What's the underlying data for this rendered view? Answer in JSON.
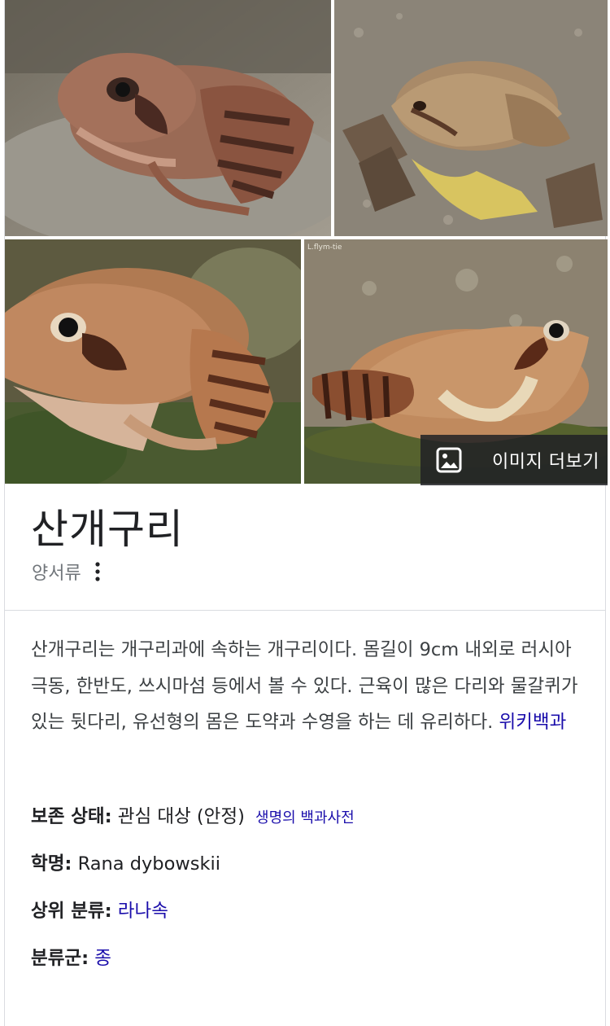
{
  "more_images_label": "이미지 더보기",
  "title": "산개구리",
  "subtitle": "양서류",
  "description": {
    "text": "산개구리는 개구리과에 속하는 개구리이다. 몸길이 9cm 내외로 러시아 극동, 한반도, 쓰시마섬 등에서 볼 수 있다. 근육이 많은 다리와 물갈퀴가 있는 뒷다리, 유선형의 몸은 도약과 수영을 하는 데 유리하다.",
    "source_link": "위키백과"
  },
  "facts": {
    "conservation": {
      "label": "보존 상태:",
      "value": "관심 대상 (안정)",
      "source": "생명의 백과사전"
    },
    "scientific_name": {
      "label": "학명:",
      "value": "Rana dybowskii"
    },
    "parent_taxon": {
      "label": "상위 분류:",
      "value": "라나속"
    },
    "rank": {
      "label": "분류군:",
      "value": "종"
    }
  },
  "photos": [
    {
      "icon": "frog-photo-1"
    },
    {
      "icon": "frog-photo-2"
    },
    {
      "icon": "frog-photo-3"
    },
    {
      "icon": "frog-photo-4",
      "watermark": "L.flym-tie"
    }
  ]
}
